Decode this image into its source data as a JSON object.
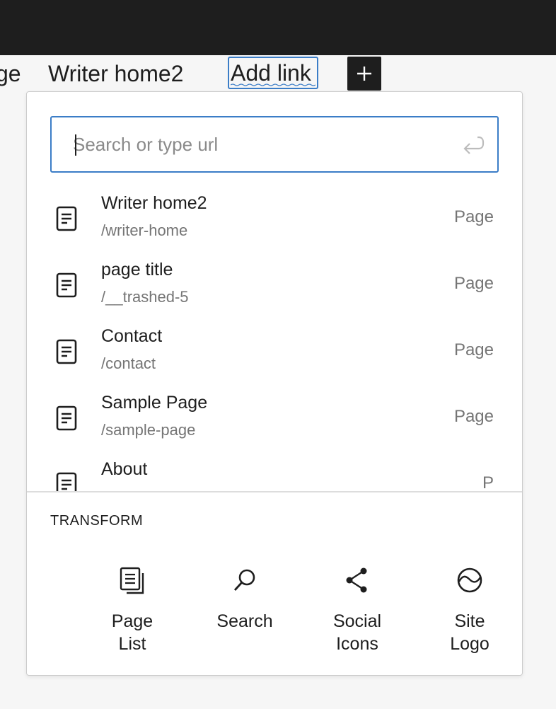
{
  "nav": {
    "partial_label": "ge",
    "writer_label": "Writer home2",
    "add_link_label": "Add link"
  },
  "search": {
    "value": "",
    "placeholder": "Search or type url"
  },
  "results": [
    {
      "title": "Writer home2",
      "url": "/writer-home",
      "type": "Page"
    },
    {
      "title": "page title",
      "url": "/__trashed-5",
      "type": "Page"
    },
    {
      "title": "Contact",
      "url": "/contact",
      "type": "Page"
    },
    {
      "title": "Sample Page",
      "url": "/sample-page",
      "type": "Page"
    },
    {
      "title": "About",
      "url": "",
      "type": "P"
    }
  ],
  "transform": {
    "heading": "TRANSFORM",
    "items": [
      {
        "label": "Page\nList",
        "icon": "page-list-icon"
      },
      {
        "label": "Search",
        "icon": "search-icon"
      },
      {
        "label": "Social\nIcons",
        "icon": "share-icon"
      },
      {
        "label": "Site\nLogo",
        "icon": "site-logo-icon"
      }
    ]
  },
  "colors": {
    "topbar": "#1e1e1e",
    "focus_border": "#3b7dc7",
    "muted_text": "#757575"
  }
}
